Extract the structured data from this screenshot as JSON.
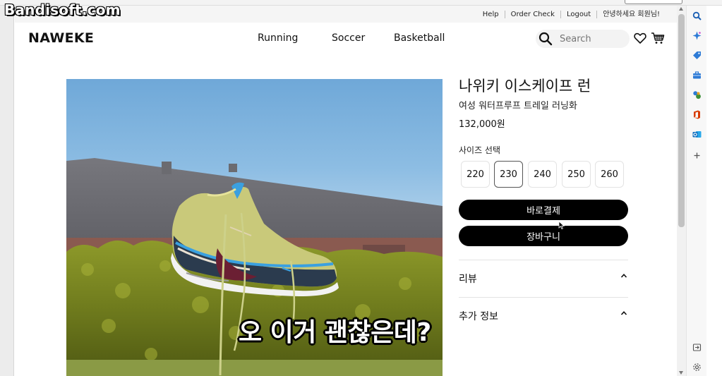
{
  "watermark": "Bandisoft.com",
  "utility_links": [
    "Help",
    "Order Check",
    "Logout",
    "안녕하세요 회원님!"
  ],
  "header": {
    "logo": "NAWEKE",
    "nav": [
      "Running",
      "Soccer",
      "Basketball"
    ],
    "search_placeholder": "Search"
  },
  "product": {
    "title": "나위키 이스케이프 런",
    "subtitle": "여성 워터프루프 트레일 러닝화",
    "price": "132,000원",
    "size_label": "사이즈 선택",
    "sizes": [
      "220",
      "230",
      "240",
      "250",
      "260"
    ],
    "selected_size": "230",
    "buy_now_label": "바로결제",
    "cart_label": "장바구니"
  },
  "accordion": {
    "review_label": "리뷰",
    "extra_info_label": "추가 정보"
  },
  "caption": "오 이거 괜찮은데?",
  "colors": {
    "accent": "#000000",
    "edge_search": "#1a5fb4",
    "edge_copilot": "#2e7bd6",
    "edge_shopping": "#2e7bd6",
    "edge_tools": "#2e7bd6",
    "edge_games": "#3f8f3a",
    "edge_office": "#d83b01",
    "edge_outlook": "#0f6cbd"
  },
  "icons": [
    "search-icon",
    "heart-icon",
    "cart-icon",
    "chevron-up-icon",
    "cursor-icon",
    "edge-search-icon",
    "edge-copilot-icon",
    "edge-shopping-icon",
    "edge-tools-icon",
    "edge-games-icon",
    "edge-office-icon",
    "edge-outlook-icon",
    "edge-add-icon",
    "edge-exit-icon",
    "edge-settings-icon"
  ]
}
